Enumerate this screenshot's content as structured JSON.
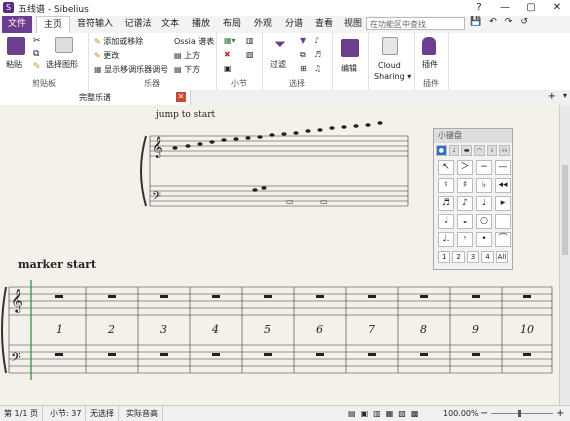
{
  "window": {
    "title": "五线谱 - Sibelius",
    "controls": [
      "?",
      "—",
      "▢",
      "✕"
    ]
  },
  "quick_access": [
    "💾",
    "↶",
    "↷",
    "↺"
  ],
  "tabs": [
    {
      "label": "文件",
      "kind": "file"
    },
    {
      "label": "主页",
      "kind": "active"
    },
    {
      "label": "音符输入"
    },
    {
      "label": "记谱法"
    },
    {
      "label": "文本"
    },
    {
      "label": "播放"
    },
    {
      "label": "布局"
    },
    {
      "label": "外观"
    },
    {
      "label": "分谱"
    },
    {
      "label": "查看"
    },
    {
      "label": "视图"
    }
  ],
  "search": {
    "placeholder": "在功能区中查找"
  },
  "ribbon": {
    "clipboard": {
      "paste": "粘贴",
      "select_graphic": "选择图形",
      "label": "剪贴板"
    },
    "instruments": {
      "add_remove": "添加或移除",
      "change": "更改",
      "show_transpose": "显示移调乐器调号",
      "ossia": "Ossia 谱表",
      "above": "上方",
      "below": "下方",
      "label": "乐器"
    },
    "bars": {
      "label": "小节"
    },
    "select": {
      "filter": "过滤",
      "label": "选择"
    },
    "edit": {
      "label": "编辑"
    },
    "cloud": {
      "line1": "Cloud",
      "line2": "Sharing ▾"
    },
    "plugins": {
      "label": "插件",
      "group_label": "插件"
    }
  },
  "doc_tab": {
    "label": "完整乐谱"
  },
  "score": {
    "top_text": "jump to start",
    "marker_text": "marker start",
    "bar_numbers": [
      "1",
      "2",
      "3",
      "4",
      "5",
      "6",
      "7",
      "8",
      "9",
      "10"
    ]
  },
  "keypad": {
    "title": "小键盘",
    "tabs": [
      "●",
      "♩",
      "▬",
      "◠",
      "♭",
      "♭♭"
    ],
    "keys": [
      "↖",
      "＞",
      "−",
      "—",
      "♮",
      "♯",
      "♭",
      "◂◂",
      "♬",
      "♪",
      "♩",
      "▸",
      "𝅗𝅥",
      "𝅝",
      "○",
      "",
      "♩.",
      "𝄾",
      "•",
      "⌒"
    ],
    "layouts": [
      "1",
      "2",
      "3",
      "4",
      "All"
    ]
  },
  "status": {
    "page": "第 1/1 页",
    "bar": "小节: 37",
    "selection": "无选择",
    "pitch": "实际音高",
    "zoom": "100.00%"
  }
}
